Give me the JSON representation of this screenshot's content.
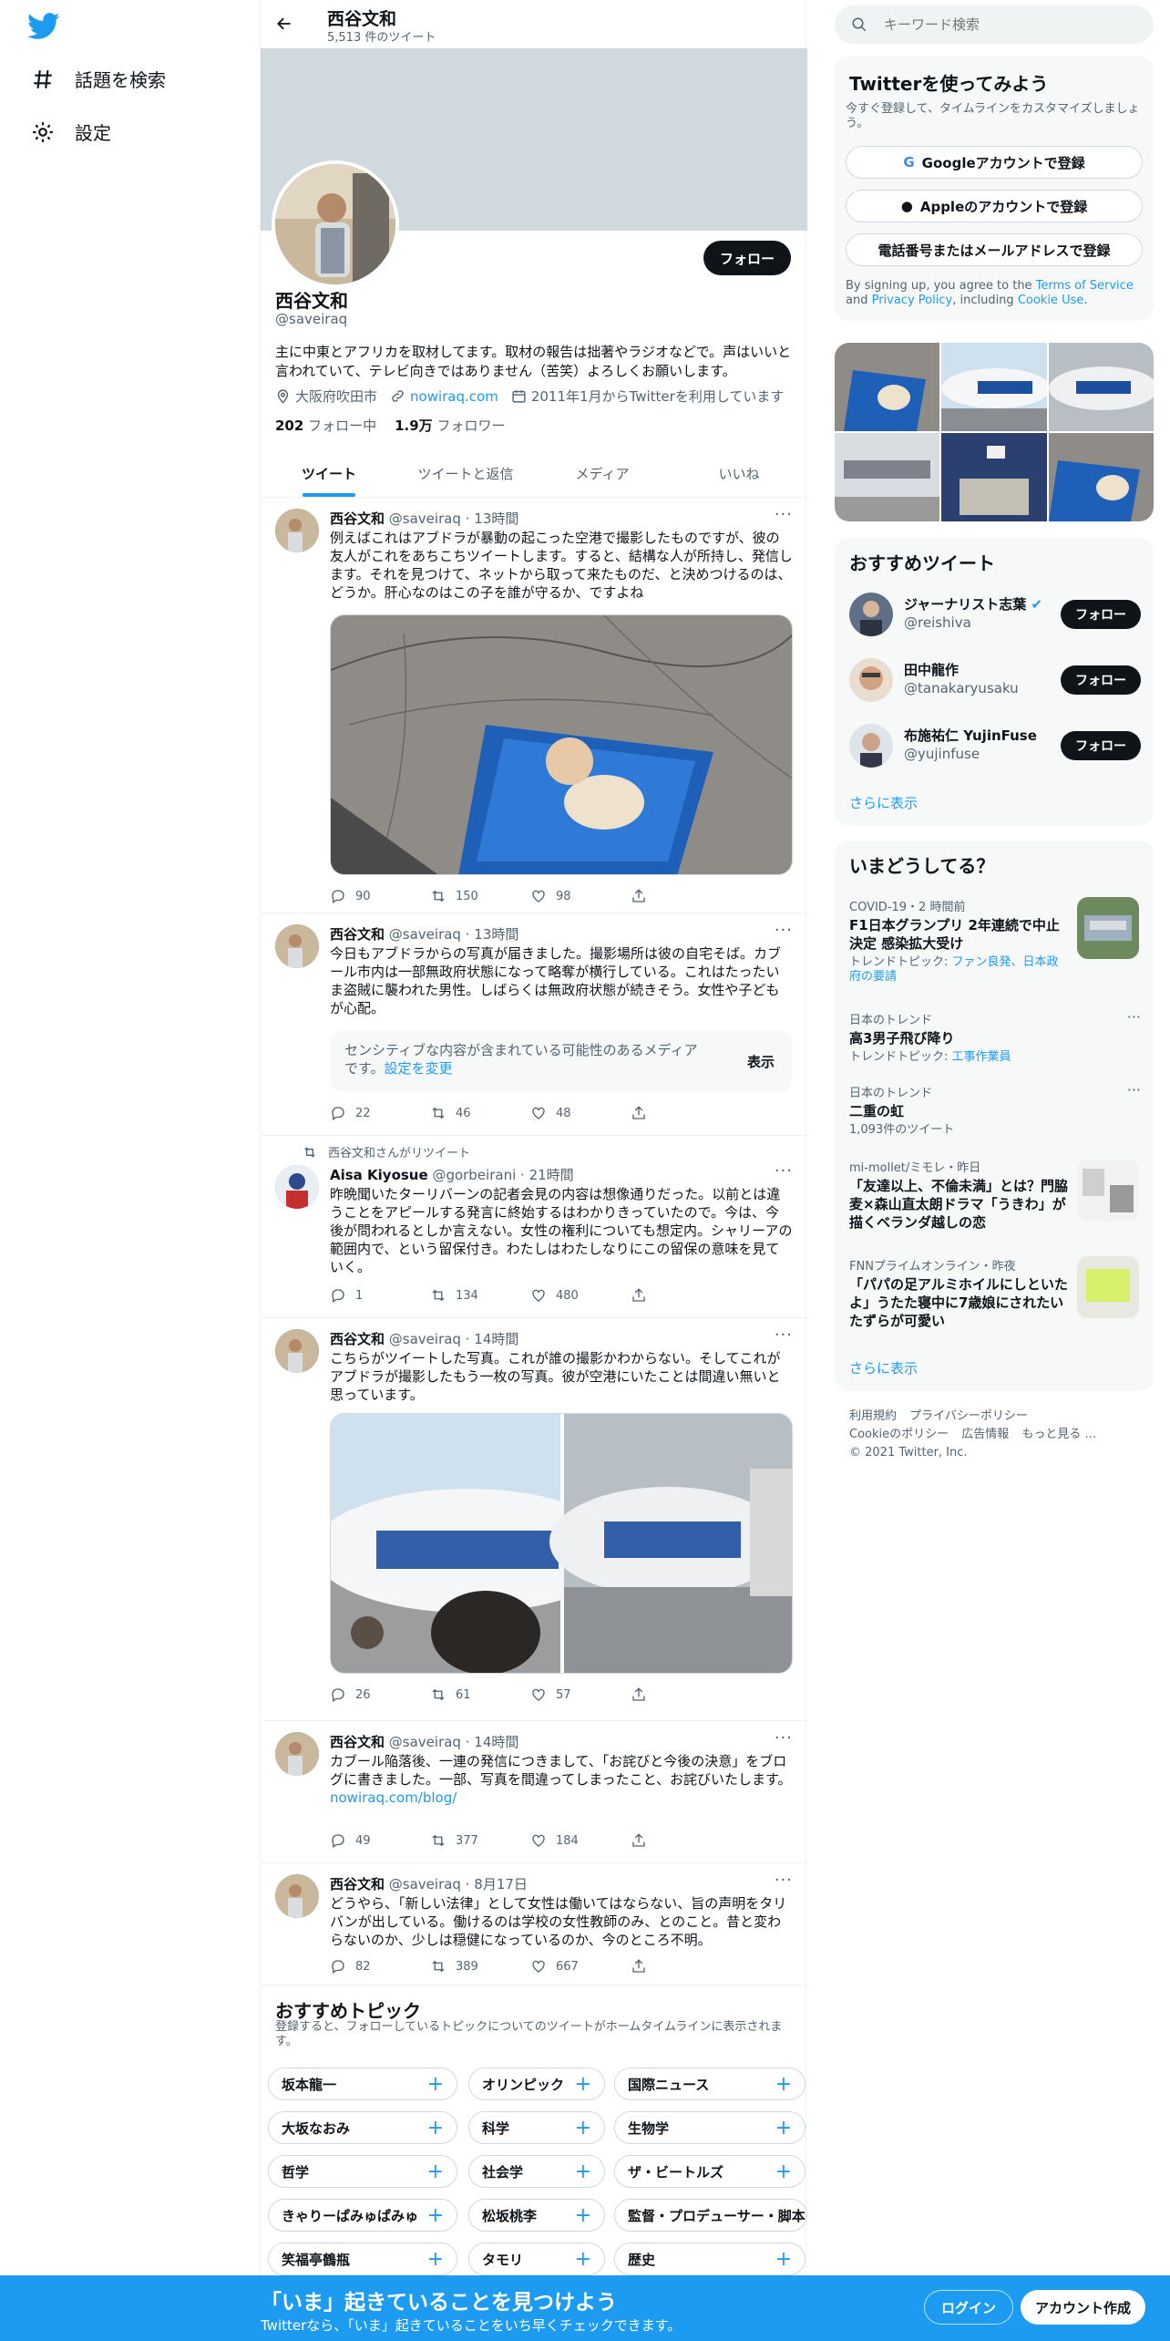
{
  "colors": {
    "accent": "#1d9bf0",
    "dark": "#0f1419",
    "muted": "#536471"
  },
  "nav": {
    "items": [
      {
        "label": "話題を検索",
        "icon": "hashtag-icon"
      },
      {
        "label": "設定",
        "icon": "gear-icon"
      }
    ]
  },
  "header": {
    "name": "西谷文和",
    "tweet_count": "5,513 件のツイート"
  },
  "profile": {
    "name": "西谷文和",
    "handle": "@saveiraq",
    "follow_label": "フォロー",
    "bio": "主に中東とアフリカを取材してます。取材の報告は拙著やラジオなどで。声はいいと言われていて、テレビ向きではありません（苦笑）よろしくお願いします。",
    "location": "大阪府吹田市",
    "website": "nowiraq.com",
    "joined": "2011年1月からTwitterを利用しています",
    "following_count": "202",
    "following_label": "フォロー中",
    "followers_count": "1.9万",
    "followers_label": "フォロワー"
  },
  "tabs": [
    "ツイート",
    "ツイートと返信",
    "メディア",
    "いいね"
  ],
  "tweets": [
    {
      "name": "西谷文和",
      "handle": "@saveiraq",
      "time": "13時間",
      "text": "例えばこれはアブドラが暴動の起こった空港で撮影したものですが、彼の友人がこれをあちこちツイートします。すると、結構な人が所持し、発信します。それを見つけて、ネットから取って来たものだ、と決めつけるのは、どうか。肝心なのはこの子を誰が守るか、ですよね",
      "replies": "90",
      "retweets": "150",
      "likes": "98"
    },
    {
      "name": "西谷文和",
      "handle": "@saveiraq",
      "time": "13時間",
      "text": "今日もアブドラからの写真が届きました。撮影場所は彼の自宅そば。カブール市内は一部無政府状態になって略奪が横行している。これはたったいま盗賊に襲われた男性。しばらくは無政府状態が続きそう。女性や子どもが心配。",
      "sensitive_text": "センシティブな内容が含まれている可能性のあるメディアです。",
      "sensitive_link": "設定を変更",
      "sensitive_show": "表示",
      "replies": "22",
      "retweets": "46",
      "likes": "48"
    },
    {
      "retweeted_by": "西谷文和さんがリツイート",
      "name": "Aisa Kiyosue",
      "handle": "@gorbeirani",
      "time": "21時間",
      "text": "昨晩聞いたターリバーンの記者会見の内容は想像通りだった。以前とは違うことをアピールする発言に終始するはわかりきっていたので。今は、今後が問われるとしか言えない。女性の権利についても想定内。シャリーアの範囲内で、という留保付き。わたしはわたしなりにこの留保の意味を見ていく。",
      "replies": "1",
      "retweets": "134",
      "likes": "480"
    },
    {
      "name": "西谷文和",
      "handle": "@saveiraq",
      "time": "14時間",
      "text": "こちらがツイートした写真。これが誰の撮影かわからない。そしてこれがアブドラが撮影したもう一枚の写真。彼が空港にいたことは間違い無いと思っています。",
      "replies": "26",
      "retweets": "61",
      "likes": "57"
    },
    {
      "name": "西谷文和",
      "handle": "@saveiraq",
      "time": "14時間",
      "text": "カブール陥落後、一連の発信につきまして、「お詫びと今後の決意」をブログに書きました。一部、写真を間違ってしまったこと、お詫びいたします。",
      "link": "nowiraq.com/blog/",
      "replies": "49",
      "retweets": "377",
      "likes": "184"
    },
    {
      "name": "西谷文和",
      "handle": "@saveiraq",
      "time": "8月17日",
      "text": "どうやら、「新しい法律」として女性は働いてはならない、旨の声明をタリバンが出している。働けるのは学校の女性教師のみ、とのこと。昔と変わらないのか、少しは穏健になっているのか、今のところ不明。",
      "replies": "82",
      "retweets": "389",
      "likes": "667"
    }
  ],
  "topics": {
    "title": "おすすめトピック",
    "subtitle": "登録すると、フォローしているトピックについてのツイートがホームタイムラインに表示されます。",
    "chips": [
      "坂本龍一",
      "オリンピック",
      "国際ニュース",
      "大坂なおみ",
      "科学",
      "生物学",
      "哲学",
      "社会学",
      "ザ・ビートルズ",
      "きゃりーぱみゅぱみゅ",
      "松坂桃李",
      "監督・プロデューサー・脚本",
      "笑福亭鶴瓶",
      "タモリ",
      "歴史"
    ]
  },
  "search": {
    "placeholder": "キーワード検索"
  },
  "signup": {
    "title": "Twitterを使ってみよう",
    "subtitle": "今すぐ登録して、タイムラインをカスタマイズしましょう。",
    "google": "Googleアカウントで登録",
    "apple": "Appleのアカウントで登録",
    "phone": "電話番号またはメールアドレスで登録",
    "terms_pre": "By signing up, you agree to the ",
    "terms_link": "Terms of Service",
    "terms_mid": " and ",
    "privacy_link": "Privacy Policy",
    "terms_mid2": ", including ",
    "cookie_link": "Cookie Use",
    "terms_end": "."
  },
  "suggestions": {
    "title": "おすすめツイート",
    "follow_label": "フォロー",
    "show_more": "さらに表示",
    "users": [
      {
        "name": "ジャーナリスト志葉",
        "handle": "@reishiva"
      },
      {
        "name": "田中龍作",
        "handle": "@tanakaryusaku"
      },
      {
        "name": "布施祐仁 YujinFuse",
        "handle": "@yujinfuse"
      }
    ]
  },
  "trends": {
    "title": "いまどうしてる？",
    "show_more": "さらに表示",
    "items": [
      {
        "ctx": "COVID-19・2 時間前",
        "title": "F1日本グランプリ 2年連続で中止決定 感染拡大受け",
        "sub_pre": "トレンドトピック: ",
        "sub_link": "ファン良発、日本政府の要請"
      },
      {
        "ctx": "日本のトレンド",
        "title": "高3男子飛び降り",
        "sub_pre": "トレンドトピック: ",
        "sub_link": "工事作業員"
      },
      {
        "ctx": "日本のトレンド",
        "title": "二重の虹",
        "sub_pre": "1,093件のツイート",
        "sub_link": ""
      },
      {
        "ctx": "mi-mollet/ミモレ・昨日",
        "title": "「友達以上、不倫未満」とは？門脇麦×森山直太朗ドラマ「うきわ」が描くベランダ越しの恋",
        "sub_pre": "",
        "sub_link": ""
      },
      {
        "ctx": "FNNプライムオンライン・昨夜",
        "title": "「パパの足アルミホイルにしといたよ」うたた寝中に7歳娘にされたいたずらが可愛い",
        "sub_pre": "",
        "sub_link": ""
      }
    ]
  },
  "footer": {
    "links": [
      "利用規約",
      "プライバシーポリシー",
      "Cookieのポリシー",
      "広告情報",
      "もっと見る ..."
    ],
    "copyright": "© 2021 Twitter, Inc."
  },
  "bottom": {
    "title": "「いま」起きていることを見つけよう",
    "subtitle": "Twitterなら、「いま」起きていることをいち早くチェックできます。",
    "login": "ログイン",
    "signup": "アカウント作成"
  }
}
